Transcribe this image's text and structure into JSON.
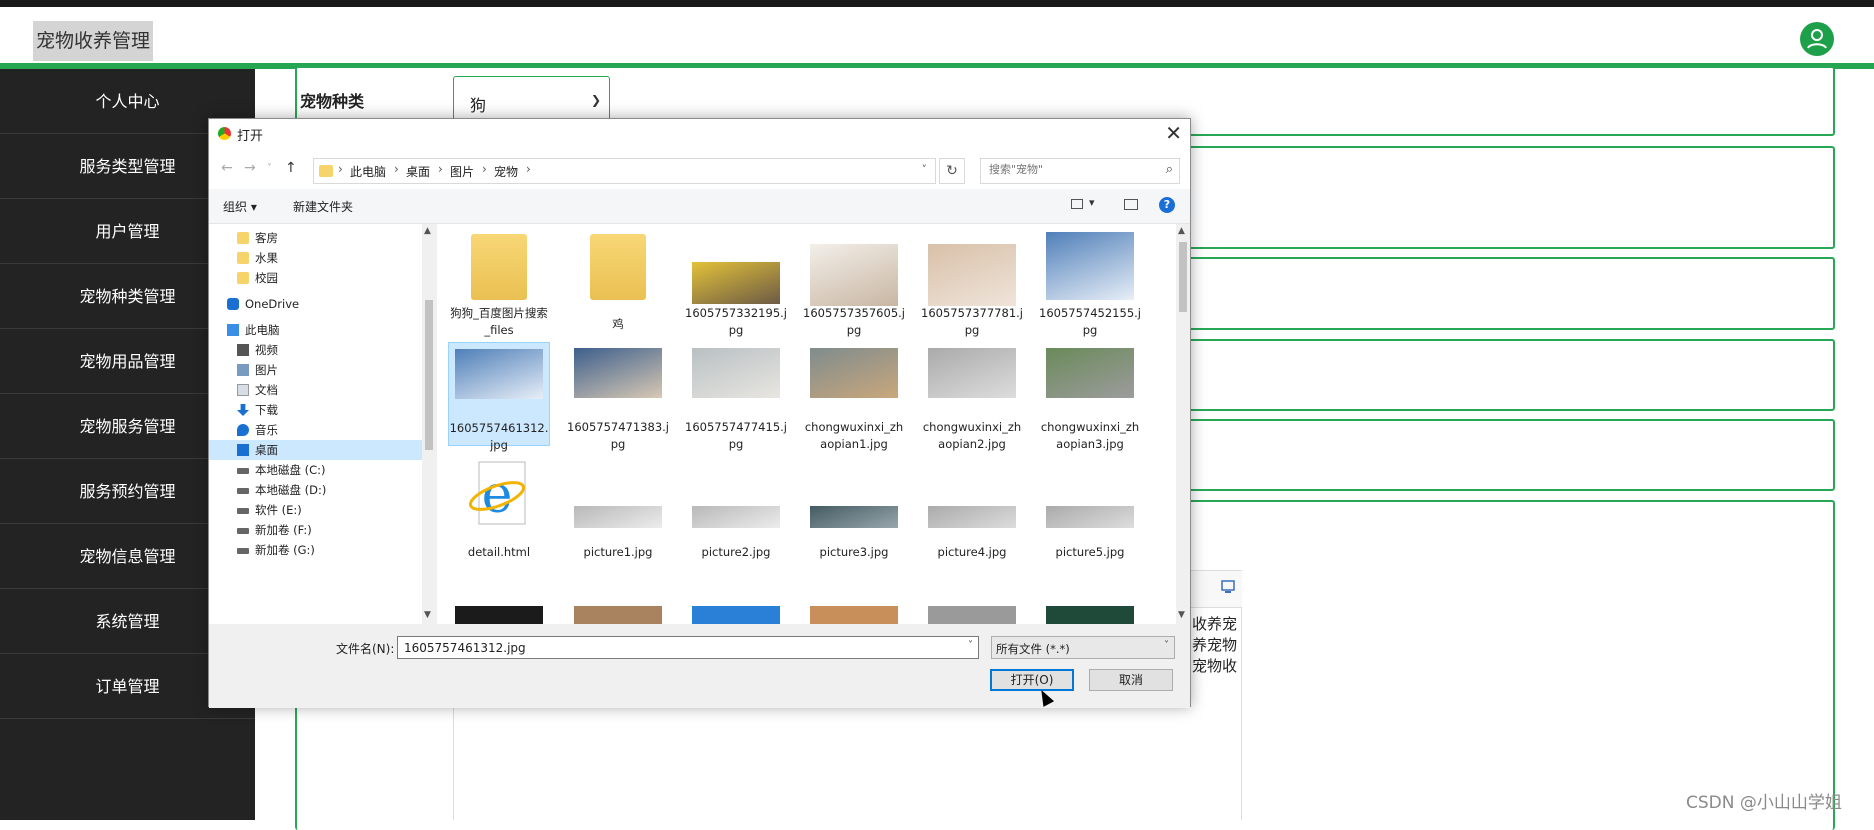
{
  "app": {
    "title": "宠物收养管理"
  },
  "sidebar": {
    "items": [
      "个人中心",
      "服务类型管理",
      "用户管理",
      "宠物种类管理",
      "宠物用品管理",
      "宠物服务管理",
      "服务预约管理",
      "宠物信息管理",
      "系统管理",
      "订单管理"
    ]
  },
  "form": {
    "species_label": "宠物种类",
    "species_value": "狗"
  },
  "editor": {
    "partial_text": "收养宠 养宠物 宠物收"
  },
  "watermark": "CSDN @小山山学姐",
  "dialog": {
    "title": "打开",
    "path": [
      "此电脑",
      "桌面",
      "图片",
      "宠物"
    ],
    "search_placeholder": "搜索\"宠物\"",
    "toolbar": {
      "organize": "组织 ▾",
      "new_folder": "新建文件夹"
    },
    "nav": [
      {
        "label": "客房",
        "icon": "folder"
      },
      {
        "label": "水果",
        "icon": "folder"
      },
      {
        "label": "校园",
        "icon": "folder"
      },
      {
        "label": "OneDrive",
        "icon": "cloud"
      },
      {
        "label": "此电脑",
        "icon": "pc"
      },
      {
        "label": "视频",
        "icon": "video"
      },
      {
        "label": "图片",
        "icon": "pic"
      },
      {
        "label": "文档",
        "icon": "doc"
      },
      {
        "label": "下载",
        "icon": "down"
      },
      {
        "label": "音乐",
        "icon": "music"
      },
      {
        "label": "桌面",
        "icon": "desk"
      },
      {
        "label": "本地磁盘 (C:)",
        "icon": "disk"
      },
      {
        "label": "本地磁盘 (D:)",
        "icon": "disk"
      },
      {
        "label": "软件 (E:)",
        "icon": "disk"
      },
      {
        "label": "新加卷 (F:)",
        "icon": "disk"
      },
      {
        "label": "新加卷 (G:)",
        "icon": "disk"
      }
    ],
    "files": [
      {
        "name": "狗狗_百度图片搜索_files",
        "kind": "folder"
      },
      {
        "name": "鸡",
        "kind": "folder"
      },
      {
        "name": "1605757332195.jpg",
        "kind": "image"
      },
      {
        "name": "1605757357605.jpg",
        "kind": "image"
      },
      {
        "name": "1605757377781.jpg",
        "kind": "image"
      },
      {
        "name": "1605757452155.jpg",
        "kind": "image"
      },
      {
        "name": "1605757461312.jpg",
        "kind": "image"
      },
      {
        "name": "1605757471383.jpg",
        "kind": "image"
      },
      {
        "name": "1605757477415.jpg",
        "kind": "image"
      },
      {
        "name": "chongwuxinxi_zhaopian1.jpg",
        "kind": "image"
      },
      {
        "name": "chongwuxinxi_zhaopian2.jpg",
        "kind": "image"
      },
      {
        "name": "chongwuxinxi_zhaopian3.jpg",
        "kind": "image"
      },
      {
        "name": "detail.html",
        "kind": "html"
      },
      {
        "name": "picture1.jpg",
        "kind": "image"
      },
      {
        "name": "picture2.jpg",
        "kind": "image"
      },
      {
        "name": "picture3.jpg",
        "kind": "image"
      },
      {
        "name": "picture4.jpg",
        "kind": "image"
      },
      {
        "name": "picture5.jpg",
        "kind": "image"
      }
    ],
    "selected_file": "1605757461312.jpg",
    "filename_label": "文件名(N):",
    "filename_value": "1605757461312.jpg",
    "filetype_value": "所有文件 (*.*)",
    "open_button": "打开(O)",
    "cancel_button": "取消",
    "colors": {
      "accent": "#0078d7",
      "selection": "#cce8ff",
      "brand_green": "#26a650"
    }
  }
}
